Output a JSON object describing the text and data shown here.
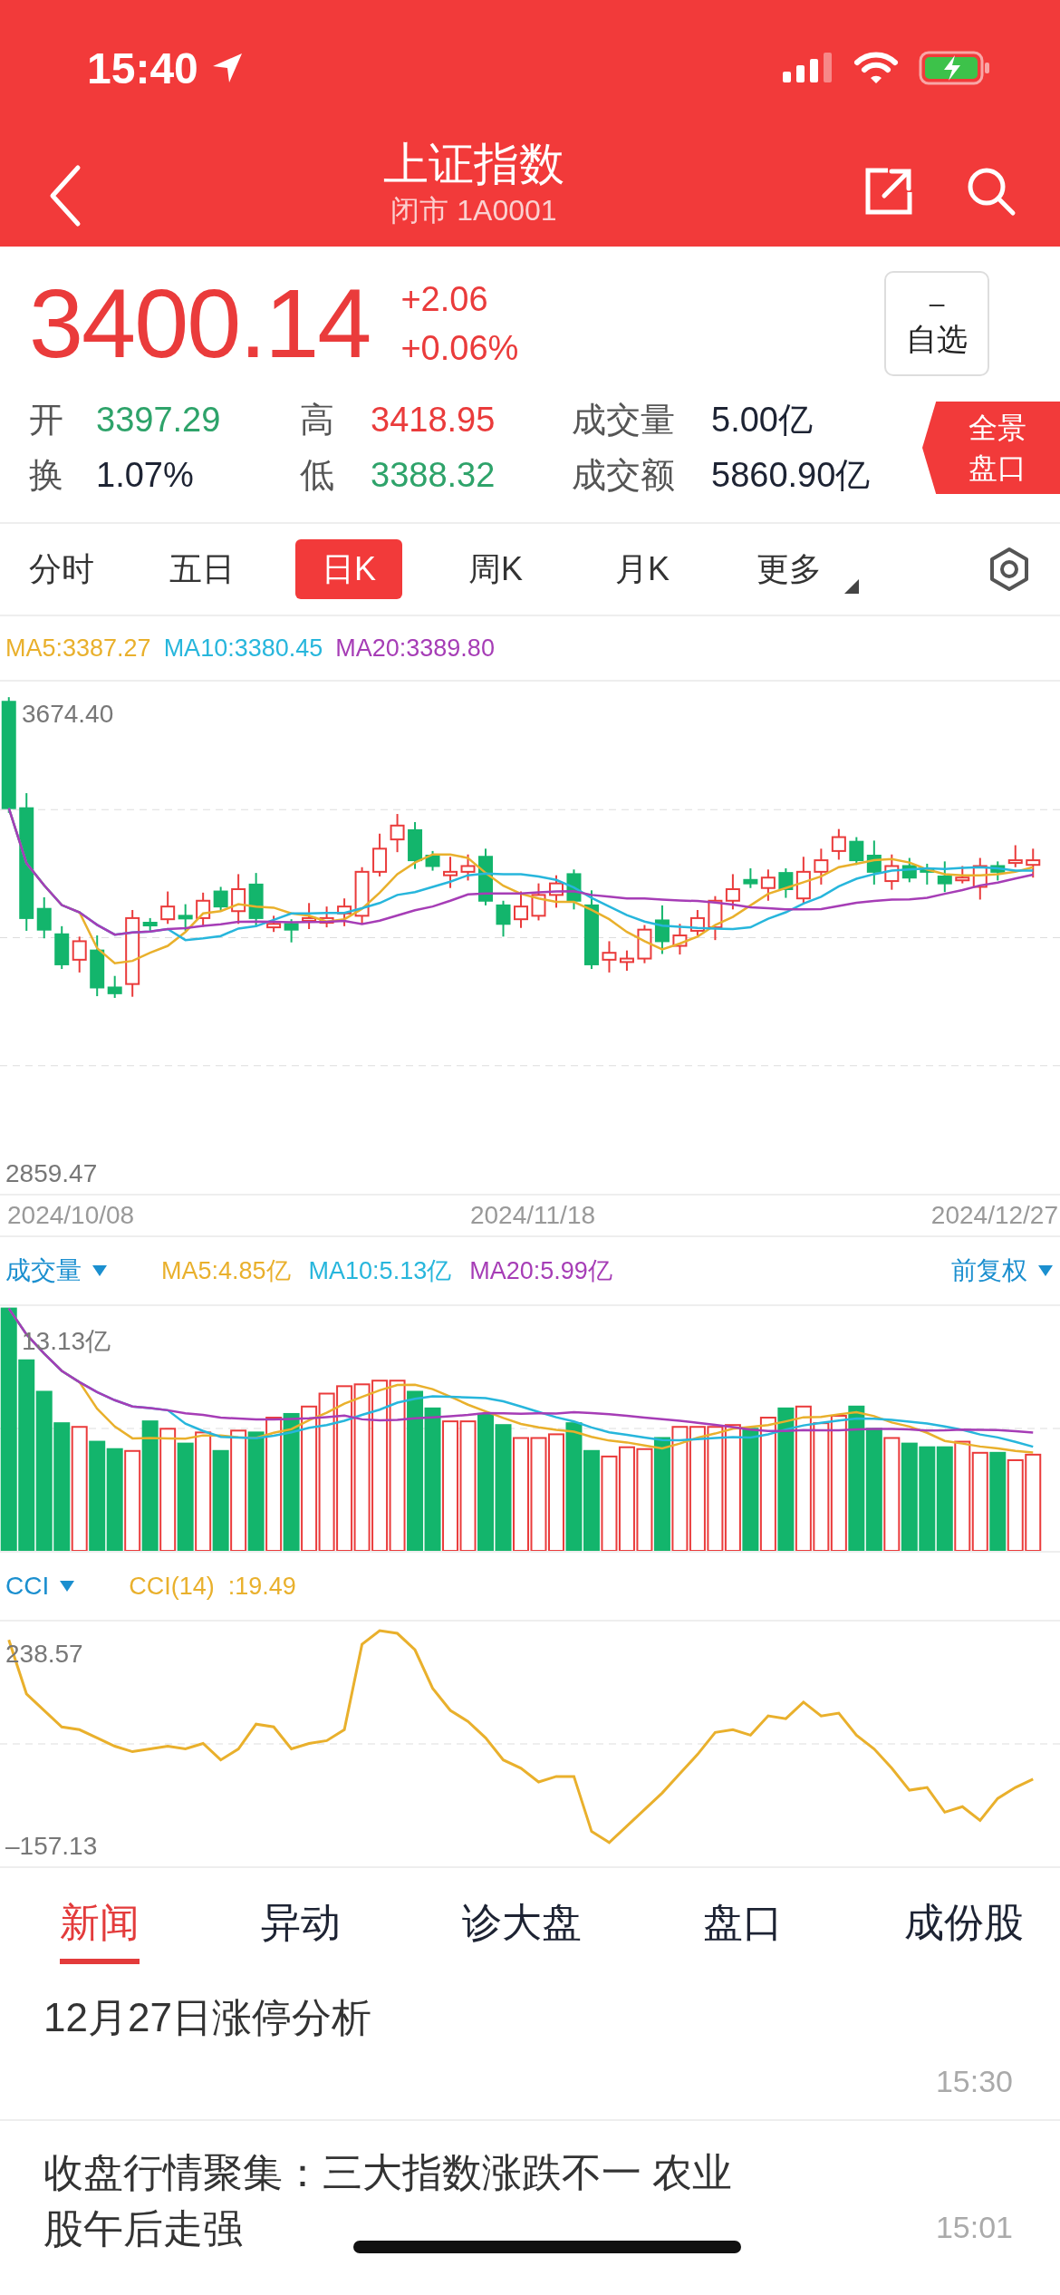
{
  "status_bar": {
    "time": "15:40"
  },
  "header": {
    "title": "上证指数",
    "subtitle": "闭市 1A0001"
  },
  "quote": {
    "price": "3400.14",
    "change": "+2.06",
    "change_pct": "+0.06%",
    "watchlist_button": {
      "symbol": "–",
      "label": "自选"
    }
  },
  "stats": [
    [
      {
        "label": "开",
        "value": "3397.29",
        "color": "#2ea36a"
      },
      {
        "label": "高",
        "value": "3418.95",
        "color": "#ea3b3b"
      },
      {
        "label": "成交量",
        "value": "5.00亿",
        "color": "#1d2333"
      }
    ],
    [
      {
        "label": "换",
        "value": "1.07%",
        "color": "#1d2333"
      },
      {
        "label": "低",
        "value": "3388.32",
        "color": "#2ea36a"
      },
      {
        "label": "成交额",
        "value": "5860.90亿",
        "color": "#1d2333"
      }
    ]
  ],
  "panorama_button": {
    "lines": [
      "全景",
      "盘口"
    ]
  },
  "period_tabs": [
    {
      "label": "分时",
      "selected": false,
      "kind": "tab"
    },
    {
      "label": "五日",
      "selected": false,
      "kind": "tab"
    },
    {
      "label": "日K",
      "selected": true,
      "kind": "tab"
    },
    {
      "label": "周K",
      "selected": false,
      "kind": "tab"
    },
    {
      "label": "月K",
      "selected": false,
      "kind": "tab"
    },
    {
      "label": "更多",
      "selected": false,
      "kind": "menu"
    }
  ],
  "kline": {
    "legend": [
      {
        "label": "MA5:3387.27",
        "color": "#e9b02c"
      },
      {
        "label": "MA10:3380.45",
        "color": "#27b6dc"
      },
      {
        "label": "MA20:3389.80",
        "color": "#a63db6"
      }
    ],
    "y_max": "3674.40",
    "y_min": "2859.47",
    "dates": [
      "2024/10/08",
      "2024/11/18",
      "2024/12/27"
    ]
  },
  "volume": {
    "indicator": "成交量",
    "legend": [
      {
        "label": "MA5:4.85亿",
        "color": "#e9b02c"
      },
      {
        "label": "MA10:5.13亿",
        "color": "#27b6dc"
      },
      {
        "label": "MA20:5.99亿",
        "color": "#a63db6"
      }
    ],
    "adjust": "前复权",
    "y_max": "13.13亿"
  },
  "cci": {
    "indicator": "CCI",
    "legend": [
      {
        "label": "CCI(14)  :19.49",
        "color": "#e9b02c"
      }
    ],
    "y_max": "238.57",
    "y_min": "–157.13"
  },
  "news_tabs": [
    {
      "label": "新闻",
      "selected": true
    },
    {
      "label": "异动",
      "selected": false
    },
    {
      "label": "诊大盘",
      "selected": false
    },
    {
      "label": "盘口",
      "selected": false
    },
    {
      "label": "成份股",
      "selected": false
    }
  ],
  "news": [
    {
      "title": "12月27日涨停分析",
      "time": "15:30"
    },
    {
      "title": "收盘行情聚集：三大指数涨跌不一 农业股午后走强",
      "time": "15:01"
    }
  ]
}
